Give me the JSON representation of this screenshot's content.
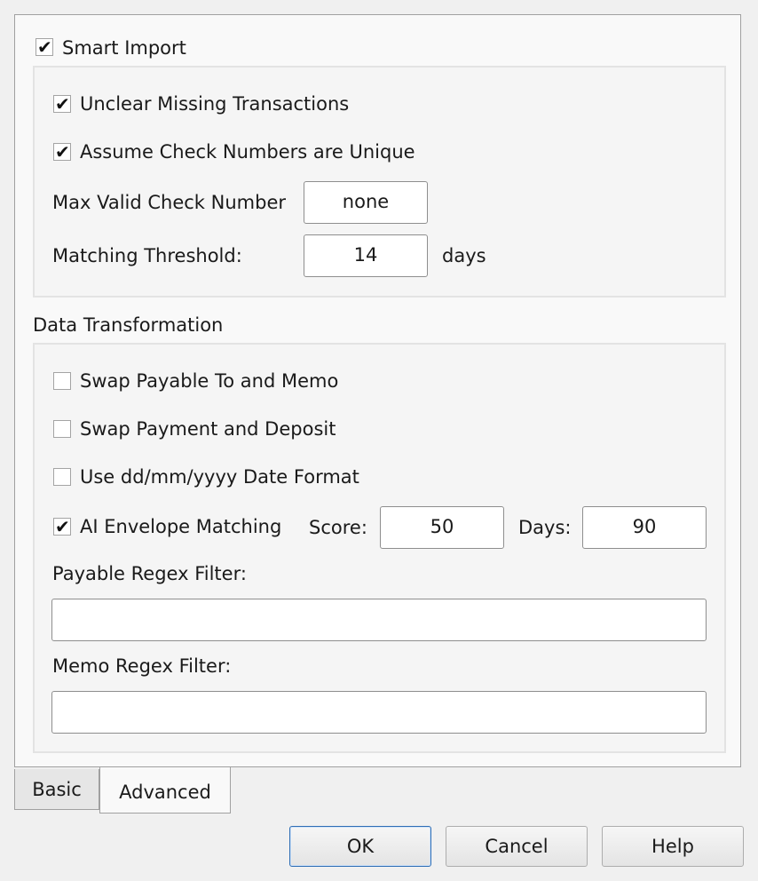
{
  "smart_import": {
    "label": "Smart Import",
    "checked": true,
    "unclear_missing": {
      "label": "Unclear Missing Transactions",
      "checked": true
    },
    "assume_unique": {
      "label": "Assume Check Numbers are Unique",
      "checked": true
    },
    "max_valid": {
      "label": "Max Valid Check Number",
      "value": "none"
    },
    "threshold": {
      "label": "Matching Threshold:",
      "value": "14",
      "unit": "days"
    }
  },
  "data_transformation": {
    "title": "Data Transformation",
    "swap_payable": {
      "label": "Swap Payable To and Memo",
      "checked": false
    },
    "swap_payment": {
      "label": "Swap Payment and Deposit",
      "checked": false
    },
    "date_format": {
      "label": "Use dd/mm/yyyy Date Format",
      "checked": false
    },
    "ai_matching": {
      "label": "AI Envelope Matching",
      "checked": true,
      "score_label": "Score:",
      "score_value": "50",
      "days_label": "Days:",
      "days_value": "90"
    },
    "payable_filter": {
      "label": "Payable Regex Filter:",
      "value": ""
    },
    "memo_filter": {
      "label": "Memo Regex Filter:",
      "value": ""
    }
  },
  "tabs": [
    {
      "label": "Basic",
      "active": false
    },
    {
      "label": "Advanced",
      "active": true
    }
  ],
  "buttons": {
    "ok": "OK",
    "cancel": "Cancel",
    "help": "Help"
  },
  "check_glyph": "✔"
}
